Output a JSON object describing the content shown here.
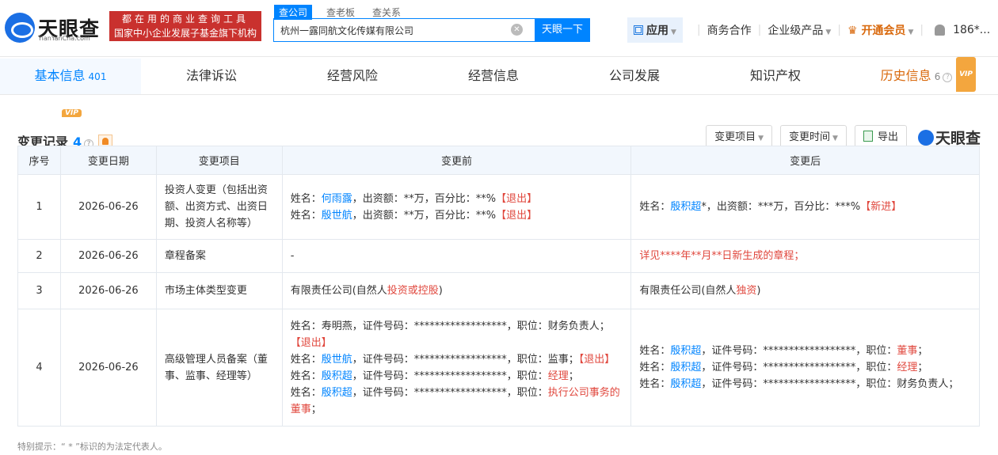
{
  "logo": {
    "name": "天眼查",
    "sub": "TianYanCha.com"
  },
  "slogan": {
    "line1": "都在用的商业查询工具",
    "line2": "国家中小企业发展子基金旗下机构"
  },
  "search": {
    "tabs": [
      "查公司",
      "查老板",
      "查关系"
    ],
    "value": "杭州一露同航文化传媒有限公司",
    "button": "天眼一下"
  },
  "topnav": {
    "app": "应用",
    "business": "商务合作",
    "enterprise": "企业级产品",
    "vip": "开通会员",
    "user": "186*..."
  },
  "tabs": [
    {
      "label": "基本信息",
      "count": "401"
    },
    {
      "label": "法律诉讼",
      "count": ""
    },
    {
      "label": "经营风险",
      "count": ""
    },
    {
      "label": "经营信息",
      "count": ""
    },
    {
      "label": "公司发展",
      "count": ""
    },
    {
      "label": "知识产权",
      "count": ""
    },
    {
      "label": "历史信息",
      "count": "6"
    }
  ],
  "vip_tag": "VIP",
  "section": {
    "title": "变更记录",
    "count": "4"
  },
  "toolbar": {
    "item": "变更项目",
    "time": "变更时间",
    "export": "导出",
    "brand": "天眼查"
  },
  "table": {
    "headers": [
      "序号",
      "变更日期",
      "变更项目",
      "变更前",
      "变更后"
    ],
    "rows": [
      {
        "no": "1",
        "date": "2026-06-26",
        "item": "投资人变更（包括出资额、出资方式、出资日期、投资人名称等）"
      },
      {
        "no": "2",
        "date": "2026-06-26",
        "item": "章程备案"
      },
      {
        "no": "3",
        "date": "2026-06-26",
        "item": "市场主体类型变更"
      },
      {
        "no": "4",
        "date": "2026-06-26",
        "item": "高级管理人员备案（董事、监事、经理等）"
      }
    ],
    "r1": {
      "b1_pre": "姓名：",
      "b1_name": "何雨露",
      "b1_mid": "，出资额：**万，百分比：**%",
      "b1_tag": "【退出】",
      "b2_pre": "姓名：",
      "b2_name": "殷世航",
      "b2_mid": "，出资额：**万，百分比：**%",
      "b2_tag": "【退出】",
      "a1_pre": "姓名：",
      "a1_name": "殷积超",
      "a1_mid": "*，出资额：***万，百分比：***%",
      "a1_tag": "【新进】"
    },
    "r2": {
      "before": "-",
      "after": "详见****年**月**日新生成的章程；"
    },
    "r3": {
      "b_pre": "有限责任公司(自然人",
      "b_red": "投资或控股",
      "b_post": ")",
      "a_pre": "有限责任公司(自然人",
      "a_red": "独资",
      "a_post": ")"
    },
    "r4": {
      "b1": "姓名：寿明燕，证件号码：******************，职位：财务负责人；",
      "b1_tag": "【退出】",
      "b2_pre": "姓名：",
      "b2_name": "殷世航",
      "b2_mid": "，证件号码：******************，职位：监事；",
      "b2_tag": "【退出】",
      "b3_pre": "姓名：",
      "b3_name": "殷积超",
      "b3_mid": "，证件号码：******************，职位：",
      "b3_pos": "经理",
      "b3_end": "；",
      "b4_pre": "姓名：",
      "b4_name": "殷积超",
      "b4_mid": "，证件号码：******************，职位：",
      "b4_pos": "执行公司事务的董事",
      "b4_end": "；",
      "a1_pre": "姓名：",
      "a1_name": "殷积超",
      "a1_mid": "，证件号码：******************，职位：",
      "a1_pos": "董事",
      "a1_end": "；",
      "a2_pre": "姓名：",
      "a2_name": "殷积超",
      "a2_mid": "，证件号码：******************，职位：",
      "a2_pos": "经理",
      "a2_end": "；",
      "a3_pre": "姓名：",
      "a3_name": "殷积超",
      "a3_mid": "，证件号码：******************，职位：财务负责人；"
    }
  },
  "note": "特别提示：“ * ”标识的为法定代表人。"
}
